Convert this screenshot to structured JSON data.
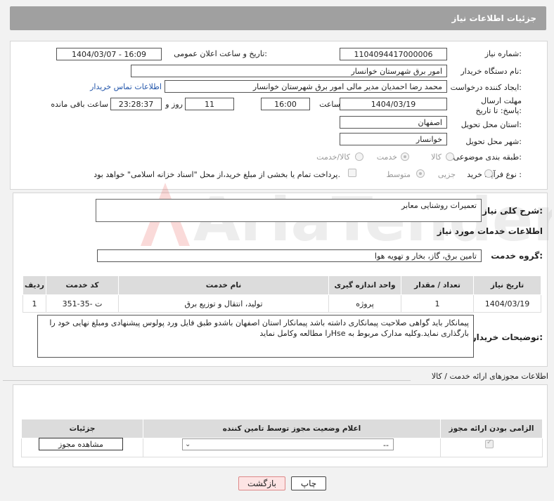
{
  "header": {
    "title": "جزئیات اطلاعات نیاز"
  },
  "labels": {
    "need_number": "شماره نیاز:",
    "announce_datetime": "تاریخ و ساعت اعلان عمومی:",
    "buyer_org": "نام دستگاه خریدار:",
    "requester": "ایجاد کننده درخواست:",
    "buyer_contact": "اطلاعات تماس خریدار",
    "deadline": "مهلت ارسال پاسخ: تا تاریخ:",
    "hour": "ساعت",
    "day_and": "روز و",
    "hours_left": "ساعت باقی مانده",
    "province": "استان محل تحویل:",
    "city": "شهر محل تحویل:",
    "category": "طبقه بندی موضوعی:",
    "process_type": "نوع فرآیند خرید :",
    "general_desc": "شرح کلی نیاز:",
    "services_info": "اطلاعات خدمات مورد نیاز",
    "service_group": "گروه خدمت:",
    "buyer_notes": "توضیحات خریدار:",
    "permits_title": "اطلاعات مجوزهای ارائه خدمت / کالا"
  },
  "values": {
    "need_number": "1104094417000006",
    "announce_datetime": "1404/03/07 - 16:09",
    "buyer_org": "امور برق شهرستان خوانسار",
    "requester": "محمد رضا احمدیان مدیر مالی امور برق شهرستان خوانسار",
    "deadline_date": "1404/03/19",
    "deadline_hour": "16:00",
    "days": "11",
    "remaining": "23:28:37",
    "province": "اصفهان",
    "city": "خوانسار",
    "general_desc": "تعمیرات روشنایی معابر",
    "service_group": "تامین برق، گاز، بخار و تهویه هوا",
    "buyer_notes": "پیمانکار باید گواهی صلاحیت پیمانکاری داشته باشد پیمانکار استان اصفهان باشدو طبق فایل ورد پولوس پیشنهادی ومبلغ نهایی خود را بارگذاری نماید.وکلیه مدارک مربوط به Hseرا مطالعه وکامل نماید"
  },
  "category_options": {
    "goods": "کالا",
    "service": "خدمت",
    "goods_service": "کالا/خدمت"
  },
  "process_options": {
    "minor": "جزیی",
    "medium": "متوسط",
    "treasury_note": "پرداخت تمام یا بخشی از مبلغ خرید،از محل \"اسناد خزانه اسلامی\" خواهد بود."
  },
  "services_table": {
    "headers": [
      "ردیف",
      "کد خدمت",
      "نام خدمت",
      "واحد اندازه گیری",
      "تعداد / مقدار",
      "تاریخ نیاز"
    ],
    "rows": [
      [
        "1",
        "ت -35-351",
        "تولید، انتقال و توزیع برق",
        "پروژه",
        "1",
        "1404/03/19"
      ]
    ]
  },
  "permits_table": {
    "headers": [
      "الزامی بودن ارائه مجوز",
      "اعلام وضعیت مجوز توسط تامین کننده",
      "جزئیات"
    ],
    "select_value": "--",
    "view_button": "مشاهده مجوز"
  },
  "buttons": {
    "print": "چاپ",
    "back": "بازگشت"
  },
  "watermark": "AriaTender.neT"
}
